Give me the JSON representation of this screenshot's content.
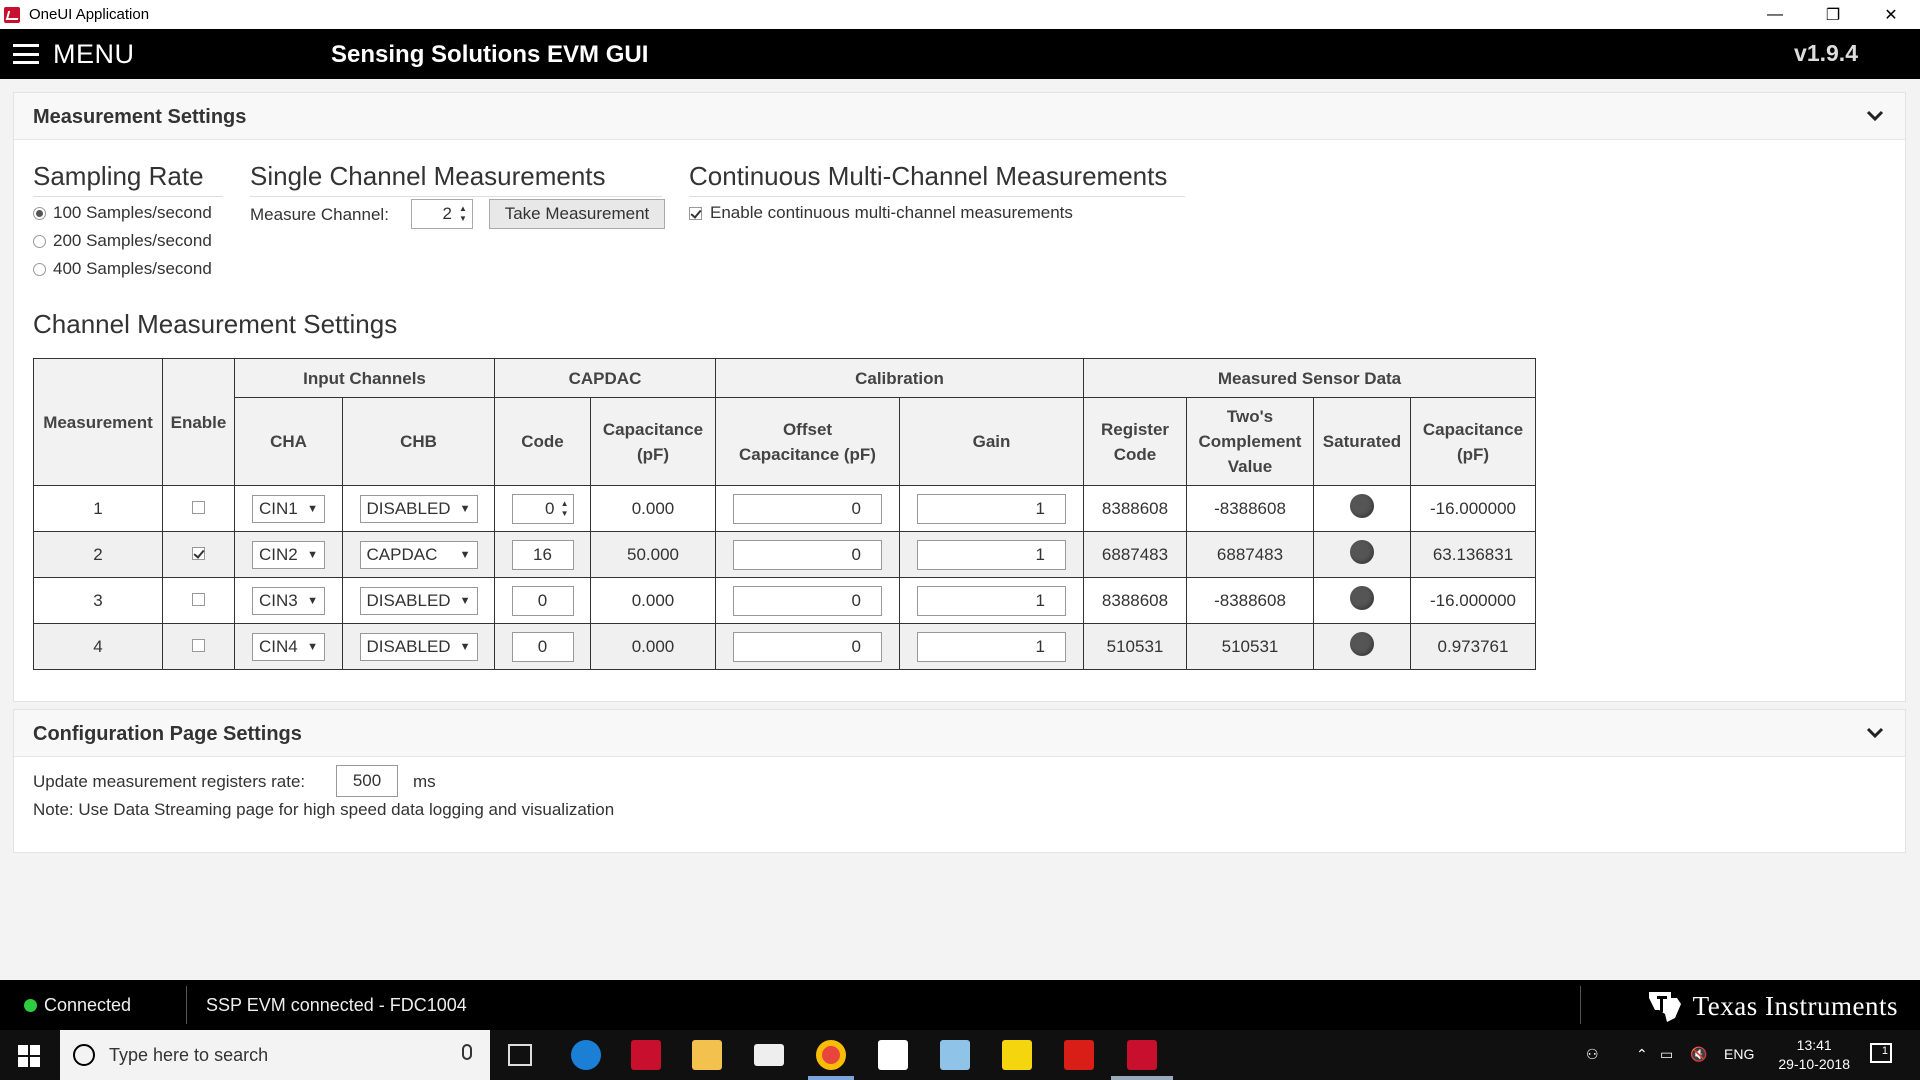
{
  "window": {
    "title": "OneUI Application",
    "minimize": "—",
    "restore": "❐",
    "close": "✕"
  },
  "header": {
    "menu_label": "MENU",
    "app_title": "Sensing Solutions EVM GUI",
    "version": "v1.9.4"
  },
  "measurement_settings": {
    "title": "Measurement Settings",
    "sampling_rate": {
      "title": "Sampling Rate",
      "options": [
        "100 Samples/second",
        "200 Samples/second",
        "400 Samples/second"
      ],
      "selected_index": 0
    },
    "single_channel": {
      "title": "Single Channel Measurements",
      "measure_channel_label": "Measure Channel:",
      "measure_channel_value": "2",
      "take_measurement_label": "Take Measurement"
    },
    "continuous": {
      "title": "Continuous Multi-Channel Measurements",
      "enable_label": "Enable continuous multi-channel measurements",
      "enabled": true
    },
    "channel_settings": {
      "title": "Channel Measurement Settings",
      "group_headers": {
        "input_channels": "Input Channels",
        "capdac": "CAPDAC",
        "calibration": "Calibration",
        "measured": "Measured Sensor Data"
      },
      "col_headers": {
        "measurement": "Measurement",
        "enable": "Enable",
        "cha": "CHA",
        "chb": "CHB",
        "code": "Code",
        "capacitance": "Capacitance (pF)",
        "offset": "Offset Capacitance (pF)",
        "gain": "Gain",
        "register_code": "Register Code",
        "twos_complement": "Two's Complement Value",
        "saturated": "Saturated",
        "meas_capacitance": "Capacitance (pF)"
      },
      "rows": [
        {
          "num": "1",
          "enabled": false,
          "cha": "CIN1",
          "chb": "DISABLED",
          "code": "0",
          "code_spinner": true,
          "capacitance": "0.000",
          "offset": "0",
          "gain": "1",
          "register_code": "8388608",
          "twos": "-8388608",
          "meas_cap": "-16.000000"
        },
        {
          "num": "2",
          "enabled": true,
          "cha": "CIN2",
          "chb": "CAPDAC",
          "code": "16",
          "code_spinner": false,
          "capacitance": "50.000",
          "offset": "0",
          "gain": "1",
          "register_code": "6887483",
          "twos": "6887483",
          "meas_cap": "63.136831"
        },
        {
          "num": "3",
          "enabled": false,
          "cha": "CIN3",
          "chb": "DISABLED",
          "code": "0",
          "code_spinner": false,
          "capacitance": "0.000",
          "offset": "0",
          "gain": "1",
          "register_code": "8388608",
          "twos": "-8388608",
          "meas_cap": "-16.000000"
        },
        {
          "num": "4",
          "enabled": false,
          "cha": "CIN4",
          "chb": "DISABLED",
          "code": "0",
          "code_spinner": false,
          "capacitance": "0.000",
          "offset": "0",
          "gain": "1",
          "register_code": "510531",
          "twos": "510531",
          "meas_cap": "0.973761"
        }
      ]
    }
  },
  "config_settings": {
    "title": "Configuration Page Settings",
    "rate_label": "Update measurement registers rate:",
    "rate_value": "500",
    "rate_unit": "ms",
    "note": "Note: Use Data Streaming page for high speed data logging and visualization"
  },
  "status": {
    "connection": "Connected",
    "device": "SSP EVM connected - FDC1004",
    "logo_text": "Texas Instruments",
    "connected_color": "#2ecc40"
  },
  "taskbar": {
    "search_placeholder": "Type here to search",
    "lang": "ENG",
    "time": "13:41",
    "date": "29-10-2018",
    "notification_count": "1"
  }
}
